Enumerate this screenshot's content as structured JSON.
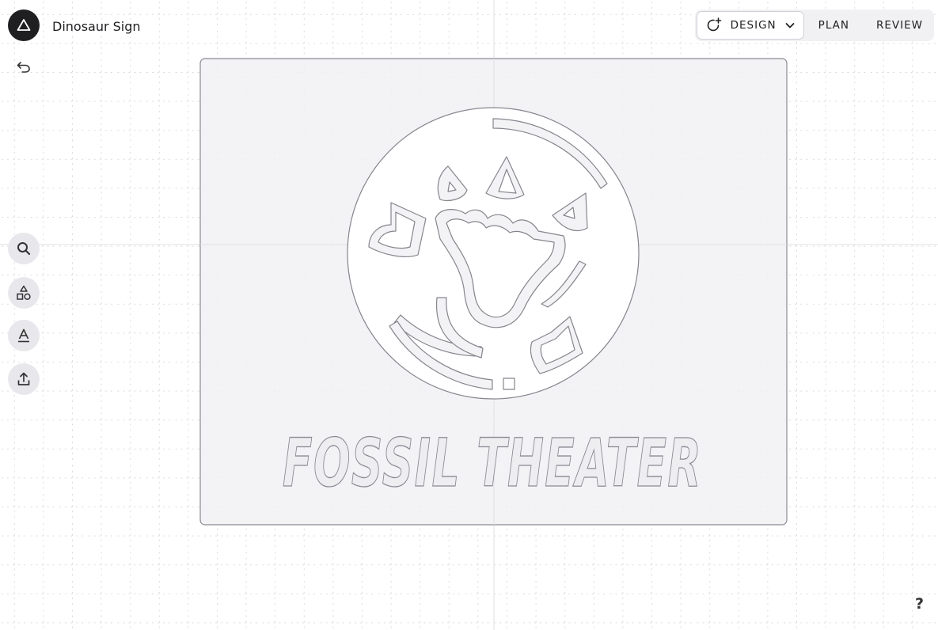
{
  "app": {
    "project_title": "Dinosaur Sign",
    "help_label": "?"
  },
  "modes": {
    "design_label": "DESIGN",
    "plan_label": "PLAN",
    "review_label": "REVIEW",
    "active": "DESIGN"
  },
  "toolbar": {
    "tools": [
      {
        "name": "search",
        "icon": "search-icon"
      },
      {
        "name": "shapes",
        "icon": "shapes-icon"
      },
      {
        "name": "text",
        "icon": "text-icon"
      },
      {
        "name": "upload",
        "icon": "upload-icon"
      }
    ]
  },
  "design": {
    "sign_text": "FOSSIL THEATER",
    "board_color": "#f1f1f4",
    "stroke_color": "#8a8a92"
  }
}
